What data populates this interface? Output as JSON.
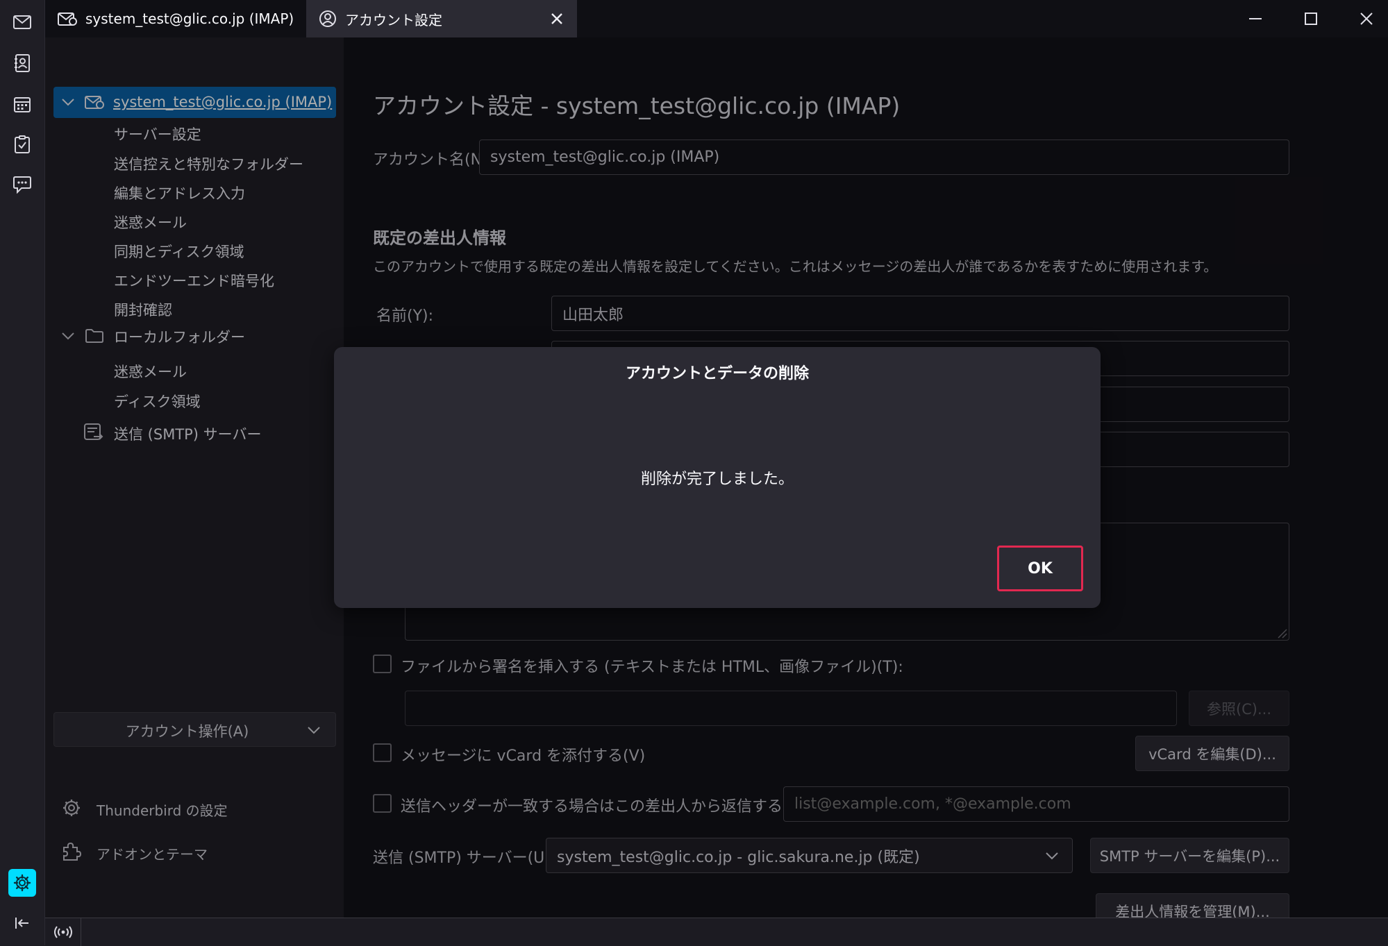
{
  "tabs": [
    {
      "label": "system_test@glic.co.jp (IMAP)",
      "icon": "mail-account-icon"
    },
    {
      "label": "アカウント設定",
      "icon": "account-settings-icon"
    }
  ],
  "sidebar": {
    "account_root": "system_test@glic.co.jp (IMAP)",
    "account_items": [
      "サーバー設定",
      "送信控えと特別なフォルダー",
      "編集とアドレス入力",
      "迷惑メール",
      "同期とディスク領域",
      "エンドツーエンド暗号化",
      "開封確認"
    ],
    "local_root": "ローカルフォルダー",
    "local_items": [
      "迷惑メール",
      "ディスク領域"
    ],
    "smtp": "送信 (SMTP) サーバー",
    "account_actions": "アカウント操作(A)",
    "settings_link": "Thunderbird の設定",
    "addons_link": "アドオンとテーマ"
  },
  "content": {
    "title": "アカウント設定 - system_test@glic.co.jp (IMAP)",
    "account_name_label": "アカウント名(N):",
    "account_name_value": "system_test@glic.co.jp (IMAP)",
    "identity_heading": "既定の差出人情報",
    "identity_desc": "このアカウントで使用する既定の差出人情報を設定してください。これはメッセージの差出人が誰であるかを表すために使用されます。",
    "name_label": "名前(Y):",
    "name_value": "山田太郎",
    "sig_file_label": "ファイルから署名を挿入する (テキストまたは HTML、画像ファイル)(T):",
    "browse_button": "参照(C)...",
    "vcard_label": "メッセージに vCard を添付する(V)",
    "vcard_button": "vCard を編集(D)...",
    "reply_label": "送信ヘッダーが一致する場合はこの差出人から返信する(D):",
    "reply_placeholder": "list@example.com, *@example.com",
    "smtp_label": "送信 (SMTP) サーバー(U):",
    "smtp_value": "system_test@glic.co.jp - glic.sakura.ne.jp (既定)",
    "smtp_edit_button": "SMTP サーバーを編集(P)...",
    "manage_button": "差出人情報を管理(M)..."
  },
  "dialog": {
    "title": "アカウントとデータの削除",
    "message": "削除が完了しました。",
    "ok": "OK"
  },
  "colors": {
    "accent": "#0b61a4",
    "active_space": "#00ddff",
    "ok_border": "#e22850"
  }
}
